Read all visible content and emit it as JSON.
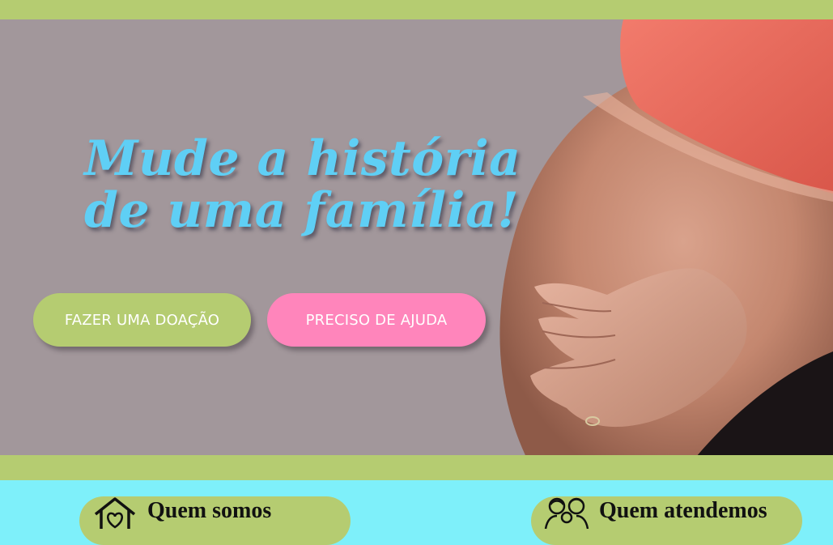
{
  "hero": {
    "title_line1": "Mude a história",
    "title_line2": "de uma família!",
    "buttons": {
      "donate_label": "FAZER UMA DOAÇÃO",
      "help_label": "PRECISO DE AJUDA"
    }
  },
  "sections": {
    "about": {
      "label": "Quem somos",
      "icon": "home-heart-icon"
    },
    "serve": {
      "label": "Quem atendemos",
      "icon": "family-icon"
    }
  },
  "colors": {
    "green": "#b5cc71",
    "pink": "#ff85bb",
    "cyan": "#7ef0fa",
    "title_blue": "#5fcff5",
    "hero_bg": "#a2979b"
  }
}
